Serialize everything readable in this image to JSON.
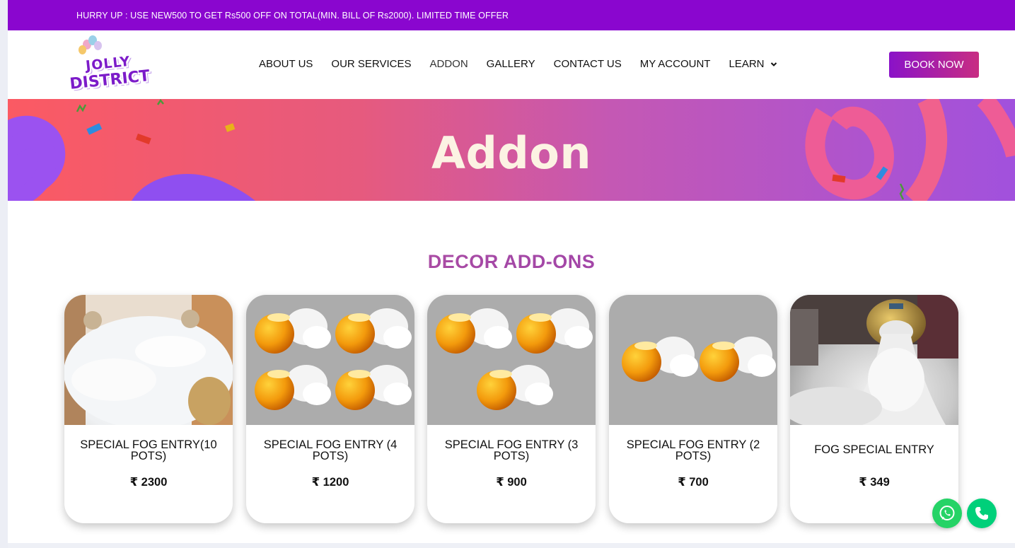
{
  "promo": {
    "text": "HURRY UP : USE NEW500 TO GET Rs500 OFF ON TOTAL(MIN. BILL OF Rs2000). LIMITED TIME OFFER"
  },
  "logo": {
    "line1": "JOLLY",
    "line2": "DISTRICT"
  },
  "nav": {
    "items": [
      {
        "label": "ABOUT US"
      },
      {
        "label": "OUR SERVICES"
      },
      {
        "label": "ADDON"
      },
      {
        "label": "GALLERY"
      },
      {
        "label": "CONTACT US"
      },
      {
        "label": "MY ACCOUNT"
      },
      {
        "label": "LEARN"
      }
    ],
    "book_label": "BOOK NOW"
  },
  "hero": {
    "title": "Addon"
  },
  "section": {
    "title": "DECOR ADD-ONS"
  },
  "cards": [
    {
      "name": "SPECIAL FOG ENTRY(10 POTS)",
      "price": "₹ 2300"
    },
    {
      "name": "SPECIAL FOG ENTRY (4 POTS)",
      "price": "₹ 1200"
    },
    {
      "name": "SPECIAL FOG ENTRY (3 POTS)",
      "price": "₹ 900"
    },
    {
      "name": "SPECIAL FOG ENTRY (2 POTS)",
      "price": "₹ 700"
    },
    {
      "name": "FOG SPECIAL ENTRY",
      "price": "₹ 349"
    }
  ],
  "icons": {
    "chevron": "chevron-down-icon",
    "whatsapp": "whatsapp-icon",
    "phone": "phone-icon"
  },
  "colors": {
    "promo_bg": "#8a06cf",
    "brand_purple": "#7c1bc9",
    "button_gradient_start": "#8a12c8",
    "button_gradient_end": "#c82d82",
    "whatsapp_green": "#25d366"
  }
}
